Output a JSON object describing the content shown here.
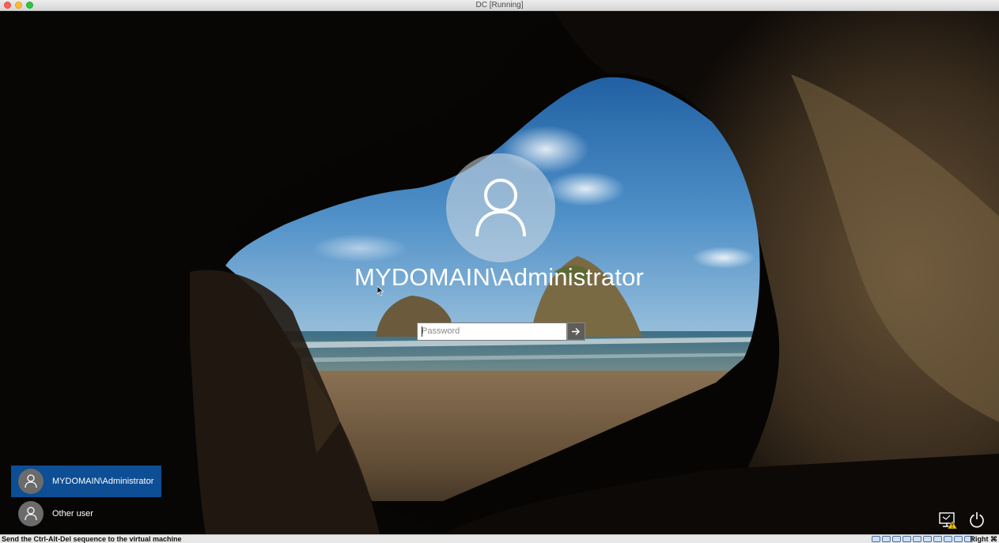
{
  "window": {
    "title": "DC [Running]"
  },
  "lockscreen": {
    "username": "MYDOMAIN\\Administrator",
    "password_placeholder": "Password"
  },
  "user_list": [
    {
      "label": "MYDOMAIN\\Administrator",
      "selected": true
    },
    {
      "label": "Other user",
      "selected": false
    }
  ],
  "corner_icons": [
    "ease-of-access-icon",
    "power-icon"
  ],
  "statusbar": {
    "message": "Send the Ctrl-Alt-Del sequence to the virtual machine",
    "host_key": "Right ⌘"
  },
  "colors": {
    "selected_tile": "#0d4e94",
    "close": "#fc5f57",
    "minimize": "#fdbc2e",
    "maximize": "#29c840"
  }
}
